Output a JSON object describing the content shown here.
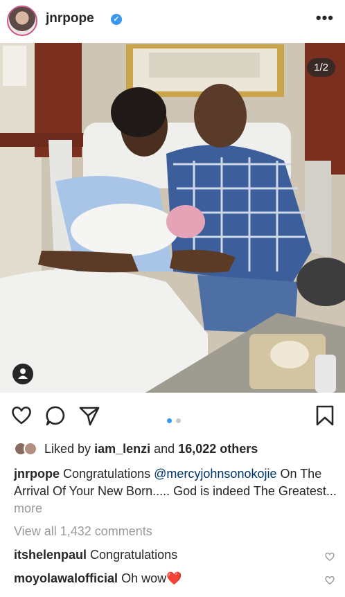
{
  "post": {
    "username": "jnrpope",
    "verified": true,
    "more_glyph": "•••",
    "image_counter": "1/2",
    "media_dots": [
      "active",
      "inactive"
    ],
    "likes": {
      "prefix": "Liked by",
      "first_liker": "iam_lenzi",
      "and": "and",
      "others": "16,022 others"
    },
    "caption": {
      "username": "jnrpope",
      "text_before": "Congratulations",
      "mention": "@mercyjohnsonokojie",
      "text_after": "On The Arrival Of Your New Born..... God is indeed The Greatest...",
      "more": "more"
    },
    "view_comments": "View all 1,432 comments",
    "comments": [
      {
        "username": "itshelenpaul",
        "text": "Congratulations"
      },
      {
        "username": "moyolawalofficial",
        "text": "Oh wow",
        "emoji": "❤️"
      }
    ]
  },
  "icons": [
    "verified-badge-icon",
    "more-options-icon",
    "user-tag-icon",
    "heart-icon",
    "comment-icon",
    "share-icon",
    "bookmark-icon"
  ],
  "colors": {
    "accent": "#3897f0",
    "text": "#262626",
    "muted": "#999999",
    "mention": "#003569"
  }
}
